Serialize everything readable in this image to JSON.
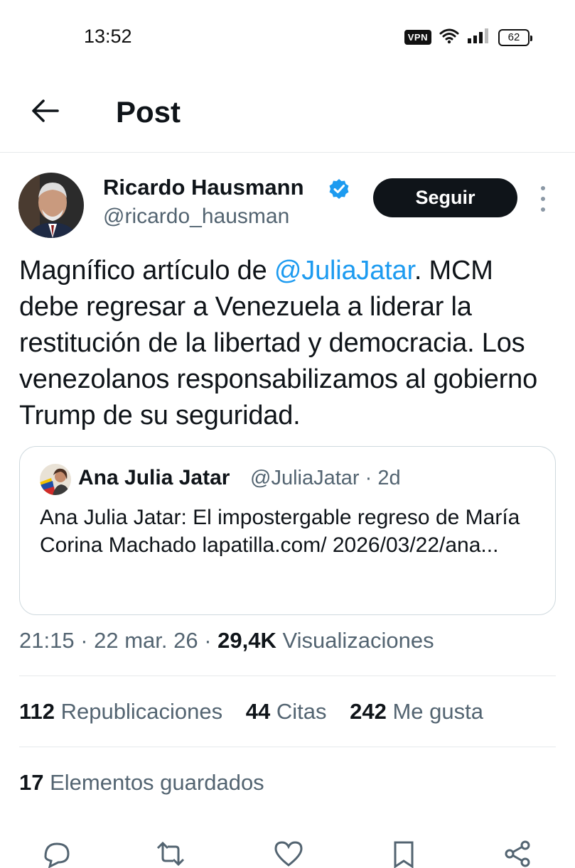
{
  "status_bar": {
    "time": "13:52",
    "vpn_label": "VPN",
    "battery_level": "62",
    "icons": [
      "wifi-icon",
      "signal-icon",
      "battery-icon"
    ]
  },
  "header": {
    "title": "Post",
    "back_icon": "arrow-left-icon"
  },
  "tweet": {
    "author_name": "Ricardo Hausmann",
    "author_handle": "@ricardo_hausman",
    "verified": true,
    "follow_label": "Seguir",
    "text_before": "Magnífico artículo de ",
    "mention": "@JuliaJatar",
    "text_after": ". MCM debe regresar a Venezuela a liderar la restitución de la libertad y democracia. Los venezolanos responsabilizamos al gobierno Trump de su seguridad."
  },
  "quote": {
    "author_name": "Ana Julia Jatar",
    "meta": "@JuliaJatar · 2d",
    "text": "Ana Julia Jatar: El impostergable regreso de María Corina Machado lapatilla.com/ 2026/03/22/ana..."
  },
  "meta": {
    "time_date": "21:15 · 22 mar. 26 · ",
    "views_count": "29,4K",
    "views_label": " Visualizaciones"
  },
  "stats": {
    "reposts_count": "112",
    "reposts_label": " Republicaciones",
    "quotes_count": "44",
    "quotes_label": " Citas",
    "likes_count": "242",
    "likes_label": " Me gusta",
    "saved_count": "17",
    "saved_label": " Elementos guardados"
  },
  "colors": {
    "accent": "#1d9bf0",
    "text_primary": "#0f1419",
    "text_secondary": "#536471",
    "follow_bg": "#0f1419"
  }
}
